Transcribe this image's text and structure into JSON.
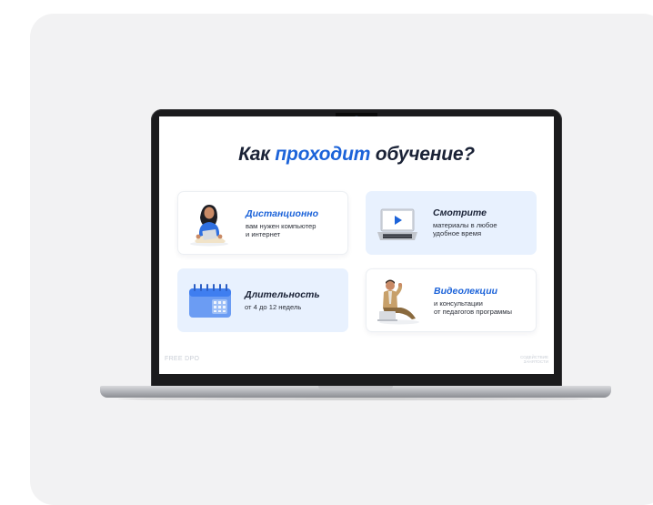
{
  "slide": {
    "title_before": "Как ",
    "title_accent": "проходит",
    "title_after": " обучение?",
    "accent_color": "#1c63d9",
    "footer_left": "FREE DPO",
    "footer_right_line1": "СОДЕЙСТВИЕ",
    "footer_right_line2": "ЗАНЯТОСТИ"
  },
  "tiles": [
    {
      "heading": "Дистанционно",
      "line1": "вам нужен компьютер",
      "line2": "и интернет",
      "style": "white",
      "icon": "student-with-laptop-icon"
    },
    {
      "heading": "Смотрите",
      "line1": "материалы в любое",
      "line2": "удобное время",
      "style": "blue",
      "icon": "laptop-play-icon"
    },
    {
      "heading": "Длительность",
      "line1": "от 4 до 12 недель",
      "line2": "",
      "style": "blue",
      "icon": "calendar-icon"
    },
    {
      "heading": "Видеолекции",
      "line1": "и консультации",
      "line2": "от педагогов программы",
      "style": "white",
      "icon": "lecturer-with-laptop-icon"
    }
  ]
}
